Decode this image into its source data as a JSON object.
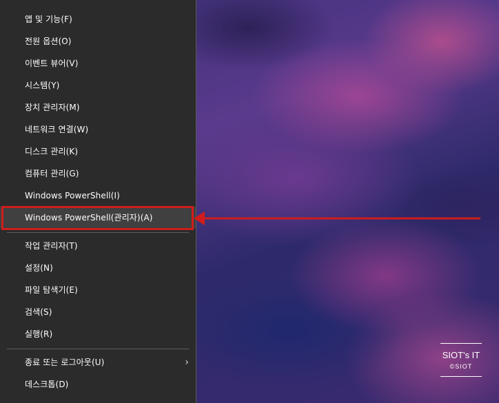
{
  "menu": {
    "items": [
      {
        "label": "앱 및 기능(F)"
      },
      {
        "label": "전원 옵션(O)"
      },
      {
        "label": "이벤트 뷰어(V)"
      },
      {
        "label": "시스템(Y)"
      },
      {
        "label": "장치 관리자(M)"
      },
      {
        "label": "네트워크 연결(W)"
      },
      {
        "label": "디스크 관리(K)"
      },
      {
        "label": "컴퓨터 관리(G)"
      },
      {
        "label": "Windows PowerShell(I)"
      },
      {
        "label": "Windows PowerShell(관리자)(A)",
        "highlighted": true
      },
      {
        "label": "작업 관리자(T)"
      },
      {
        "label": "설정(N)"
      },
      {
        "label": "파일 탐색기(E)"
      },
      {
        "label": "검색(S)"
      },
      {
        "label": "실행(R)"
      },
      {
        "label": "종료 또는 로그아웃(U)",
        "submenu": true,
        "chevron": "›"
      },
      {
        "label": "데스크톱(D)"
      }
    ]
  },
  "annotation": {
    "highlight_color": "#d01c1c",
    "arrow_icon": "left-arrow"
  },
  "watermark": {
    "title": "SIOT's IT",
    "copyright": "©SIOT"
  },
  "colors": {
    "menu_background": "#2b2b2b",
    "menu_hover": "#404040",
    "text": "#ffffff"
  }
}
